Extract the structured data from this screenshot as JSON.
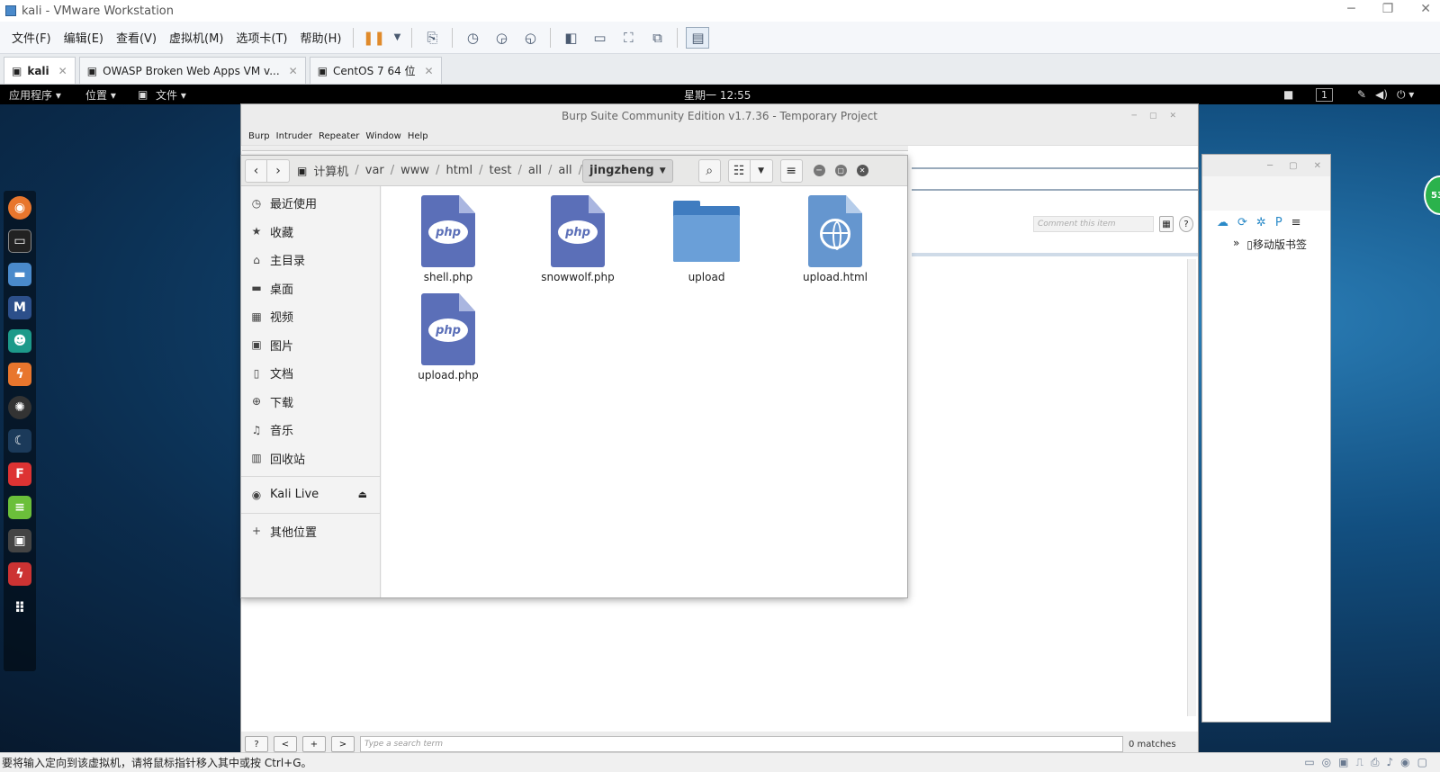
{
  "vm": {
    "title": "kali - VMware Workstation",
    "menus": [
      "文件(F)",
      "编辑(E)",
      "查看(V)",
      "虚拟机(M)",
      "选项卡(T)",
      "帮助(H)"
    ],
    "tabs": [
      {
        "label": "kali"
      },
      {
        "label": "OWASP Broken Web Apps VM v..."
      },
      {
        "label": "CentOS 7 64 位"
      }
    ],
    "status": "要将输入定向到该虚拟机，请将鼠标指针移入其中或按 Ctrl+G。"
  },
  "guest_topbar": {
    "apps": "应用程序 ▾",
    "places": "位置 ▾",
    "files": "文件 ▾",
    "clock": "星期一 12:55",
    "workspace": "1"
  },
  "burp": {
    "title": "Burp Suite Community Edition v1.7.36 - Temporary Project",
    "menu": [
      "Burp",
      "Intruder",
      "Repeater",
      "Window",
      "Help"
    ],
    "comment_placeholder": "Comment this item",
    "search_placeholder": "Type a search term",
    "matches": "0 matches",
    "btn_help": "?",
    "btn_prev": "<",
    "btn_add": "+",
    "btn_next": ">"
  },
  "browser": {
    "bookmark": "移动版书签",
    "badge": "53"
  },
  "filemanager": {
    "breadcrumb": [
      "计算机",
      "var",
      "www",
      "html",
      "test",
      "all",
      "all"
    ],
    "current": "jingzheng",
    "sidebar": [
      {
        "icon": "clock-icon",
        "glyph": "◷",
        "label": "最近使用"
      },
      {
        "icon": "star-icon",
        "glyph": "★",
        "label": "收藏"
      },
      {
        "icon": "home-icon",
        "glyph": "⌂",
        "label": "主目录"
      },
      {
        "icon": "folder-icon",
        "glyph": "▬",
        "label": "桌面"
      },
      {
        "icon": "video-icon",
        "glyph": "▦",
        "label": "视频"
      },
      {
        "icon": "image-icon",
        "glyph": "▣",
        "label": "图片"
      },
      {
        "icon": "document-icon",
        "glyph": "▯",
        "label": "文档"
      },
      {
        "icon": "download-icon",
        "glyph": "⊕",
        "label": "下载"
      },
      {
        "icon": "music-icon",
        "glyph": "♫",
        "label": "音乐"
      },
      {
        "icon": "trash-icon",
        "glyph": "▥",
        "label": "回收站"
      }
    ],
    "device": "Kali Live",
    "other": "其他位置",
    "files": [
      {
        "name": "shell.php",
        "kind": "php"
      },
      {
        "name": "snowwolf.php",
        "kind": "php"
      },
      {
        "name": "upload",
        "kind": "folder"
      },
      {
        "name": "upload.html",
        "kind": "html"
      },
      {
        "name": "upload.php",
        "kind": "php"
      }
    ],
    "php_badge": "php"
  },
  "colors": {
    "accent": "#5b6fb8",
    "folder": "#3f7cc0",
    "burp_orange": "#e8762d"
  }
}
